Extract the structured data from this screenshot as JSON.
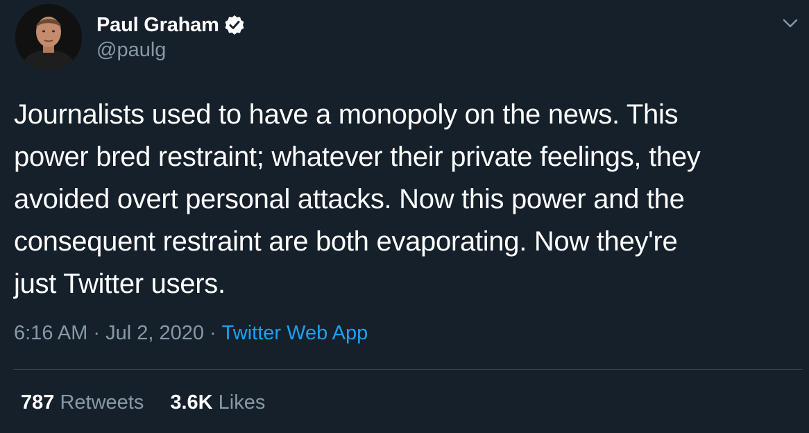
{
  "author": {
    "display_name": "Paul Graham",
    "handle": "@paulg",
    "verified": true,
    "avatar_icon": "profile-photo"
  },
  "tweet": {
    "lines": [
      "Journalists used to have a monopoly on the news. This",
      "power bred restraint; whatever their private feelings, they",
      "avoided overt personal attacks. Now this power and the",
      "consequent restraint are both evaporating. Now they're",
      "just Twitter users."
    ]
  },
  "meta": {
    "time": "6:16 AM",
    "separator": "·",
    "date": "Jul 2, 2020",
    "source": "Twitter Web App"
  },
  "stats": {
    "retweets_count": "787",
    "retweets_label": "Retweets",
    "likes_count": "3.6K",
    "likes_label": "Likes"
  },
  "colors": {
    "background": "#15202b",
    "text_primary": "#ffffff",
    "text_secondary": "#8899a6",
    "accent": "#1da1f2",
    "divider": "#38444d"
  }
}
